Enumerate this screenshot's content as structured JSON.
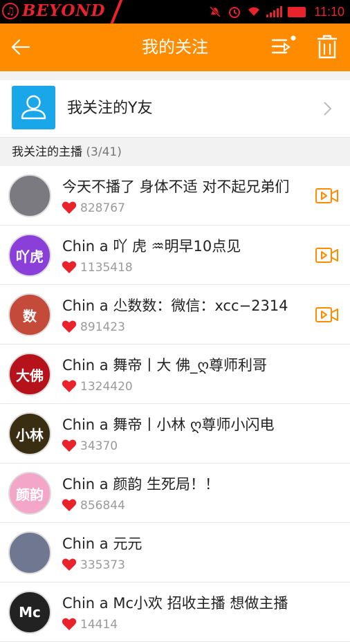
{
  "status_bar": {
    "brand": "BEYOND",
    "time": "11:10"
  },
  "header": {
    "title": "我的关注"
  },
  "friend_entry": {
    "label": "我关注的Y友"
  },
  "section": {
    "title": "我关注的主播",
    "count": "(3/41)"
  },
  "colors": {
    "accent": "#ff8c00",
    "friend_icon_bg": "#1aa7ea",
    "heart": "#e8232b",
    "live_icon": "#ff8c00"
  },
  "anchors": [
    {
      "name": "今天不播了 身体不适  对不起兄弟们",
      "fans": "828767",
      "live": true,
      "avatar_text": "",
      "avatar_color": "#7a7a80"
    },
    {
      "name": "Chin a  吖 虎 ♒明早10点见",
      "fans": "1135418",
      "live": true,
      "avatar_text": "吖虎",
      "avatar_color": "#8a3fd8"
    },
    {
      "name": "Chin a 尐数数：微信：xcc−2314",
      "fans": "891423",
      "live": true,
      "avatar_text": "数",
      "avatar_color": "#c44a3a"
    },
    {
      "name": "Chin a 舞帝丨大 佛_ღ尊师利哥",
      "fans": "1324420",
      "live": false,
      "avatar_text": "大佛",
      "avatar_color": "#b5121b"
    },
    {
      "name": "Chin a 舞帝丨小林 ღ尊师小闪电",
      "fans": "34370",
      "live": false,
      "avatar_text": "小林",
      "avatar_color": "#3a2e12"
    },
    {
      "name": "Chin a 颜韵 生死局！！",
      "fans": "856844",
      "live": false,
      "avatar_text": "颜韵",
      "avatar_color": "#f4a6c8"
    },
    {
      "name": "Chin a 元元",
      "fans": "335373",
      "live": false,
      "avatar_text": "",
      "avatar_color": "#6f7890"
    },
    {
      "name": "Chin a Mc小欢 招收主播 想做主播",
      "fans": "14414",
      "live": false,
      "avatar_text": "Mc",
      "avatar_color": "#222222"
    }
  ]
}
